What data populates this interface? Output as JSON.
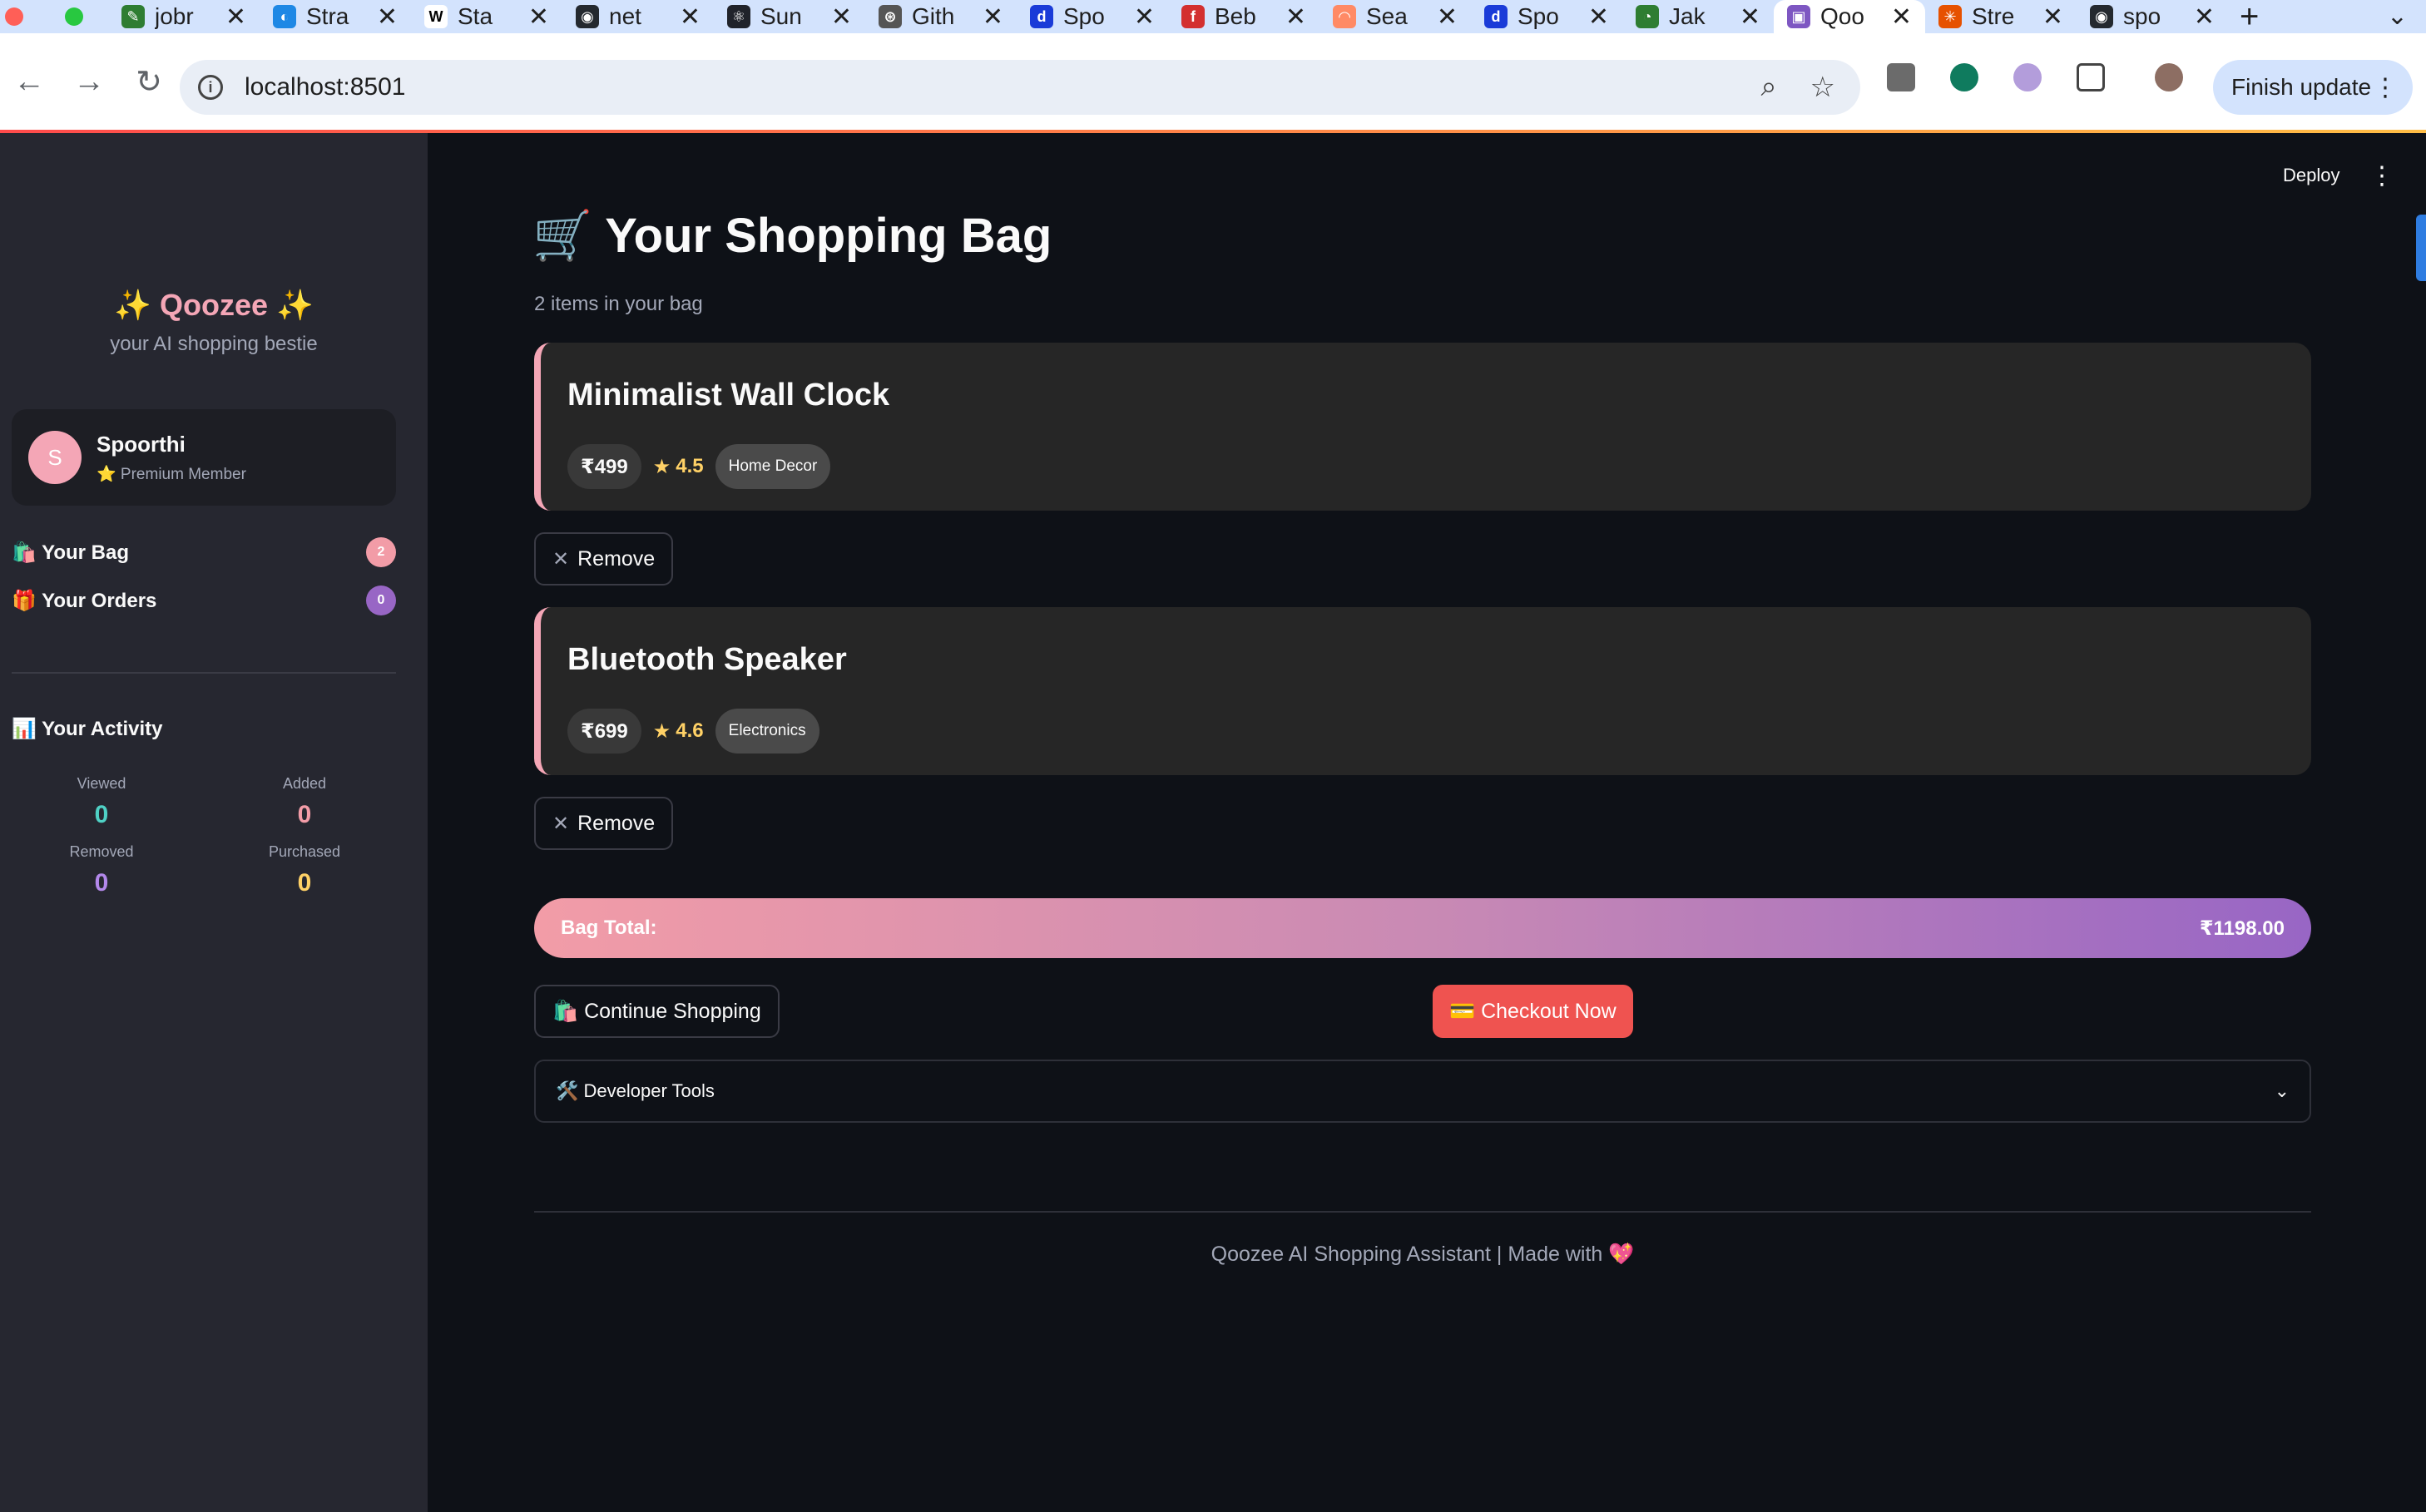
{
  "browser": {
    "tabs": [
      {
        "label": "jobr",
        "fav_color": "#2e7d32",
        "fav_glyph": "✎"
      },
      {
        "label": "Stra",
        "fav_color": "#1e88e5",
        "fav_glyph": "◐"
      },
      {
        "label": "Sta",
        "fav_color": "#ffffff",
        "fav_glyph": "W"
      },
      {
        "label": "net",
        "fav_color": "#24292f",
        "fav_glyph": "◉"
      },
      {
        "label": "Sun",
        "fav_color": "#20232a",
        "fav_glyph": "⚛"
      },
      {
        "label": "Gith",
        "fav_color": "#555555",
        "fav_glyph": "⊛"
      },
      {
        "label": "Spo",
        "fav_color": "#1a3bd8",
        "fav_glyph": "d"
      },
      {
        "label": "Beb",
        "fav_color": "#d32f2f",
        "fav_glyph": "f"
      },
      {
        "label": "Sea",
        "fav_color": "#ff8a65",
        "fav_glyph": "◠"
      },
      {
        "label": "Spo",
        "fav_color": "#1a3bd8",
        "fav_glyph": "d"
      },
      {
        "label": "Jak",
        "fav_color": "#2e7d32",
        "fav_glyph": "◔"
      },
      {
        "label": "Qoo",
        "fav_color": "#7e57c2",
        "fav_glyph": "▣",
        "active": true
      },
      {
        "label": "Stre",
        "fav_color": "#e65100",
        "fav_glyph": "✳"
      },
      {
        "label": "spo",
        "fav_color": "#24292f",
        "fav_glyph": "◉"
      }
    ],
    "url": "localhost:8501",
    "finish_update": "Finish update"
  },
  "sidebar": {
    "brand": "✨ Qoozee ✨",
    "tagline": "your AI shopping bestie",
    "user": {
      "initial": "S",
      "name": "Spoorthi",
      "tier": "⭐ Premium Member"
    },
    "links": [
      {
        "label": "🛍️ Your Bag",
        "badge": "2",
        "badge_color": "#f29ca7"
      },
      {
        "label": "🎁 Your Orders",
        "badge": "0",
        "badge_color": "#9866c5"
      }
    ],
    "activity_title": "📊 Your Activity",
    "stats": [
      {
        "label": "Viewed",
        "value": "0",
        "color": "#4fd1c5"
      },
      {
        "label": "Added",
        "value": "0",
        "color": "#f29ca7"
      },
      {
        "label": "Removed",
        "value": "0",
        "color": "#b388eb"
      },
      {
        "label": "Purchased",
        "value": "0",
        "color": "#ffd166"
      }
    ]
  },
  "header": {
    "deploy": "Deploy"
  },
  "main": {
    "title": "🛒 Your Shopping Bag",
    "subtitle": "2 items in your bag",
    "items": [
      {
        "name": "Minimalist Wall Clock",
        "price": "₹499",
        "rating": "4.5",
        "category": "Home Decor"
      },
      {
        "name": "Bluetooth Speaker",
        "price": "₹699",
        "rating": "4.6",
        "category": "Electronics"
      }
    ],
    "remove_label": "Remove",
    "total_label": "Bag Total:",
    "total_value": "₹1198.00",
    "continue_label": "🛍️ Continue Shopping",
    "checkout_label": "💳 Checkout Now",
    "dev_tools_label": "🛠️ Developer Tools",
    "footer": "Qoozee AI Shopping Assistant | Made with 💖"
  }
}
